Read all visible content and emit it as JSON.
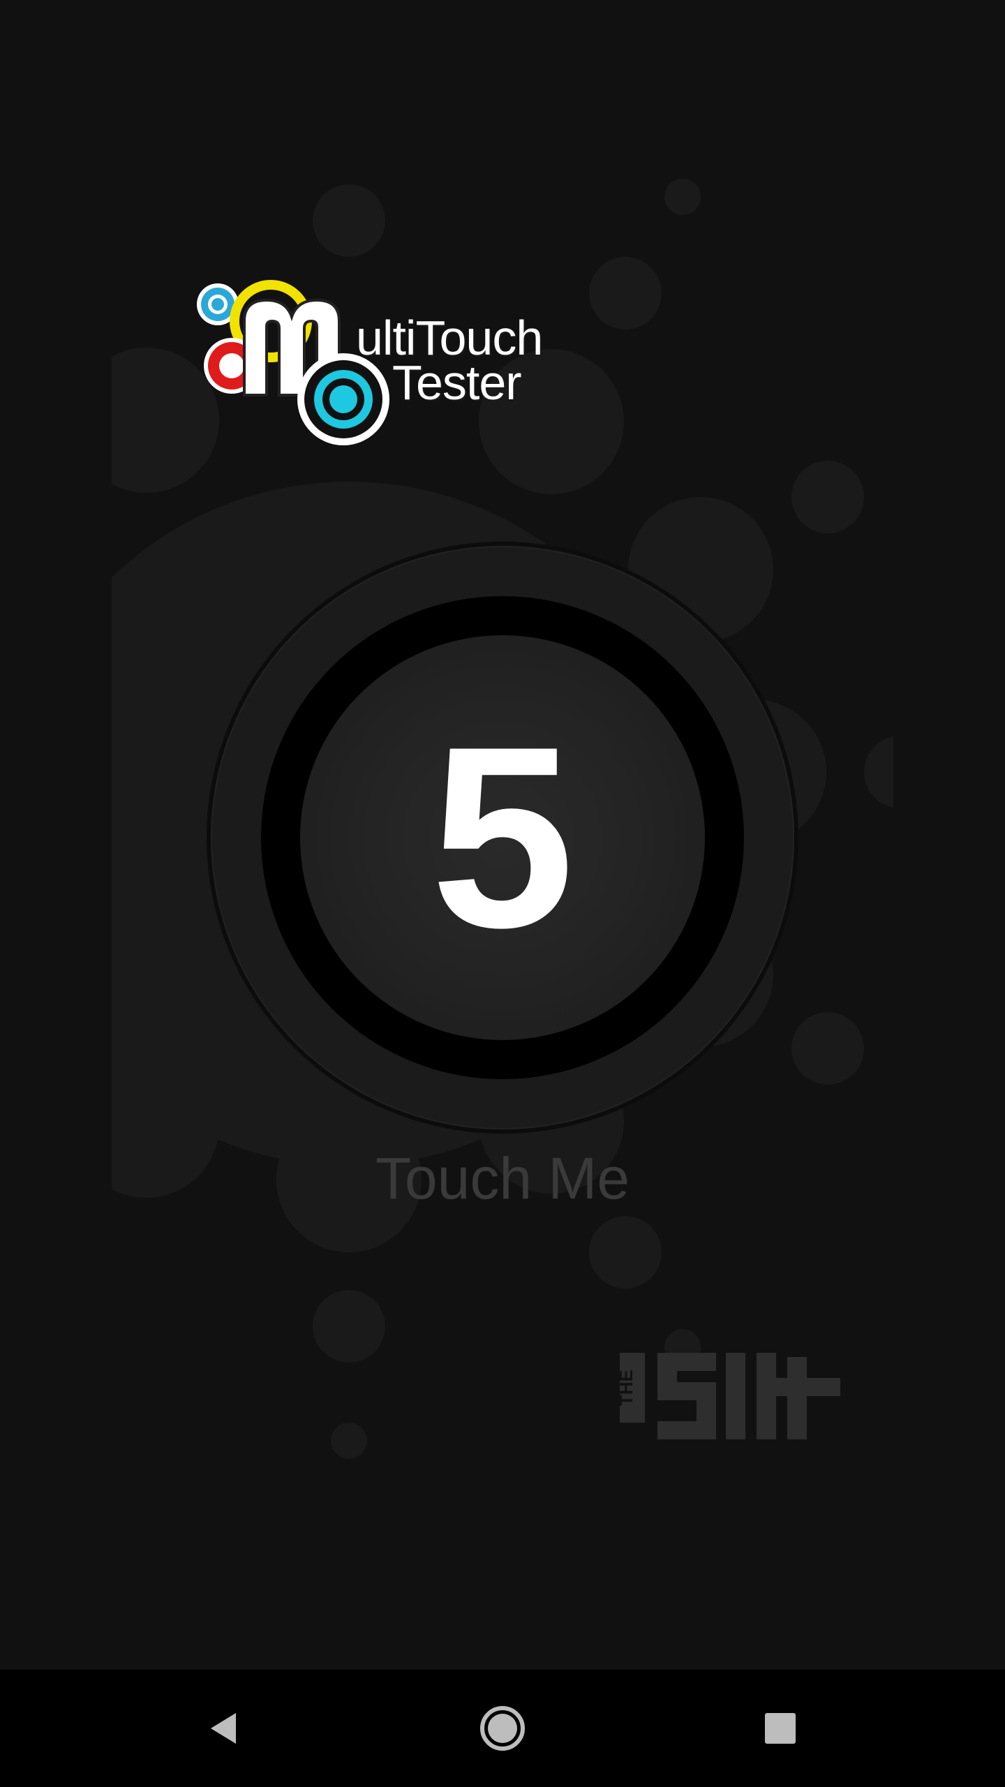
{
  "app": {
    "logo_line1": "ultiTouch",
    "logo_line2": "Tester",
    "logo_letter": "M"
  },
  "main": {
    "touch_count": "5",
    "touch_label": "Touch Me"
  },
  "brand": {
    "prefix": "THE",
    "name": "SIT"
  },
  "navbar": {
    "back_icon": "back-triangle-icon",
    "home_icon": "home-circle-icon",
    "recents_icon": "recents-square-icon"
  },
  "colors": {
    "background": "#111111",
    "ring": "#1b1b1b",
    "logo_cyan": "#1ec8e0",
    "logo_yellow": "#f2e200",
    "logo_red": "#e01b1b",
    "logo_blue": "#2aa8d8"
  }
}
